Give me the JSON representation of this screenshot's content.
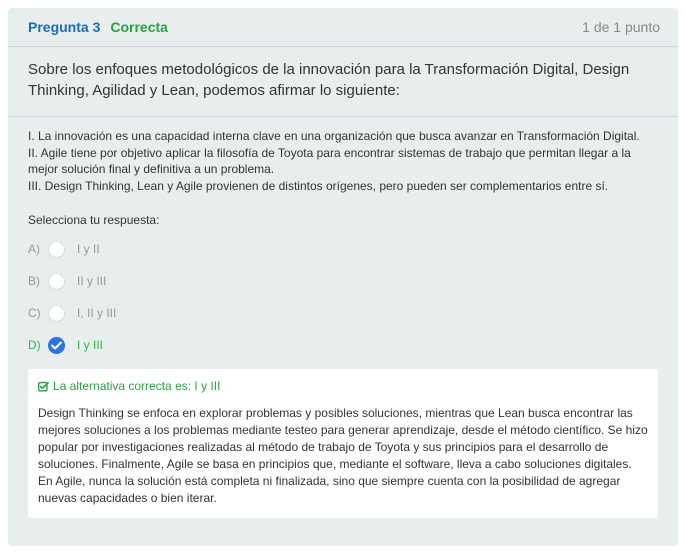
{
  "header": {
    "question_label": "Pregunta 3",
    "status": "Correcta",
    "points": "1 de 1 punto"
  },
  "question": {
    "text": "Sobre los enfoques metodológicos de la innovación para la Transformación Digital, Design Thinking, Agilidad y Lean, podemos afirmar lo siguiente:"
  },
  "statements": [
    "I. La innovación es una capacidad interna clave en una organización que busca avanzar en Transformación Digital.",
    "II. Agile tiene por objetivo aplicar la filosofía de Toyota para encontrar sistemas de trabajo que permitan llegar a la mejor solución final y definitiva a un problema.",
    "III. Design Thinking, Lean y Agile provienen de distintos orígenes, pero pueden ser complementarios entre sí."
  ],
  "prompt": "Selecciona tu respuesta:",
  "options": [
    {
      "letter": "A)",
      "text": "I y II",
      "selected": false
    },
    {
      "letter": "B)",
      "text": "II y III",
      "selected": false
    },
    {
      "letter": "C)",
      "text": "I, II y III",
      "selected": false
    },
    {
      "letter": "D)",
      "text": "I y III",
      "selected": true
    }
  ],
  "feedback": {
    "icon": "check-square-icon",
    "title": "La alternativa correcta es: I y III",
    "body": "Design Thinking se enfoca en explorar problemas y posibles soluciones, mientras que Lean busca encontrar las mejores soluciones a los problemas mediante testeo para generar aprendizaje, desde el método científico. Se hizo popular por investigaciones realizadas al método de trabajo de Toyota y sus principios para el desarrollo de soluciones. Finalmente, Agile se basa en principios que, mediante el software, lleva a cabo soluciones digitales. En Agile, nunca la solución está completa ni finalizada, sino que siempre cuenta con la posibilidad de agregar nuevas capacidades o bien iterar."
  },
  "colors": {
    "card_bg": "#e8eeee",
    "question_label": "#1a6db0",
    "correct_green": "#2e9e46",
    "radio_checked": "#2c72e0"
  }
}
